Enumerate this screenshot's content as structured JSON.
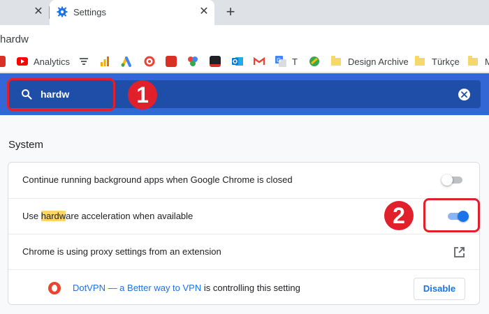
{
  "tabs": {
    "active_title": "Settings"
  },
  "omnibox": {
    "text": "hardw"
  },
  "bookmarks": [
    {
      "label": "",
      "icon": "bookmark-red-icon",
      "color": "#d93025"
    },
    {
      "label": "Analytics",
      "icon": "youtube-analytics-icon",
      "color": "#ff0000"
    },
    {
      "label": "",
      "icon": "bookmark-pinwheel-icon",
      "color": "#5f6368"
    },
    {
      "label": "",
      "icon": "google-analytics-icon",
      "color": "#f9ab00"
    },
    {
      "label": "",
      "icon": "google-ads-icon",
      "color": "#4285f4"
    },
    {
      "label": "",
      "icon": "bookmark-swirl-icon",
      "color": "#ea4335"
    },
    {
      "label": "",
      "icon": "bookmark-red-square-icon",
      "color": "#d93025"
    },
    {
      "label": "",
      "icon": "bookmark-colorful-icon",
      "color": "#34a853"
    },
    {
      "label": "",
      "icon": "bookmark-dark-icon",
      "color": "#202124"
    },
    {
      "label": "",
      "icon": "outlook-icon",
      "color": "#0078d4"
    },
    {
      "label": "",
      "icon": "gmail-icon",
      "color": "#ea4335"
    },
    {
      "label": "T",
      "icon": "google-translate-icon",
      "color": "#4285f4"
    },
    {
      "label": "",
      "icon": "bookmark-green-circle-icon",
      "color": "#34a853"
    },
    {
      "label": "Design Archive",
      "icon": "folder-icon",
      "color": "#f5d867"
    },
    {
      "label": "Türkçe",
      "icon": "folder-icon",
      "color": "#f5d867"
    },
    {
      "label": "M",
      "icon": "folder-icon",
      "color": "#f5d867"
    }
  ],
  "search": {
    "value": "hardw"
  },
  "annotations": {
    "badge1": "1",
    "badge2": "2"
  },
  "section": {
    "title": "System"
  },
  "settings": {
    "background_apps": {
      "label": "Continue running background apps when Google Chrome is closed",
      "enabled": false
    },
    "hardware_accel": {
      "label_highlight": "hardw",
      "label_rest": "are acceleration when available",
      "label_prefix": "Use ",
      "enabled": true
    },
    "proxy": {
      "label": "Chrome is using proxy settings from an extension"
    },
    "vpn": {
      "link_text": "DotVPN — a Better way to VPN",
      "suffix": " is controlling this setting",
      "button": "Disable"
    }
  },
  "colors": {
    "search_band": "#3367d6",
    "search_box": "#1f4ea8",
    "annotation": "#e0202a",
    "toggle_on": "#1a73e8",
    "highlight": "#fdd663"
  }
}
